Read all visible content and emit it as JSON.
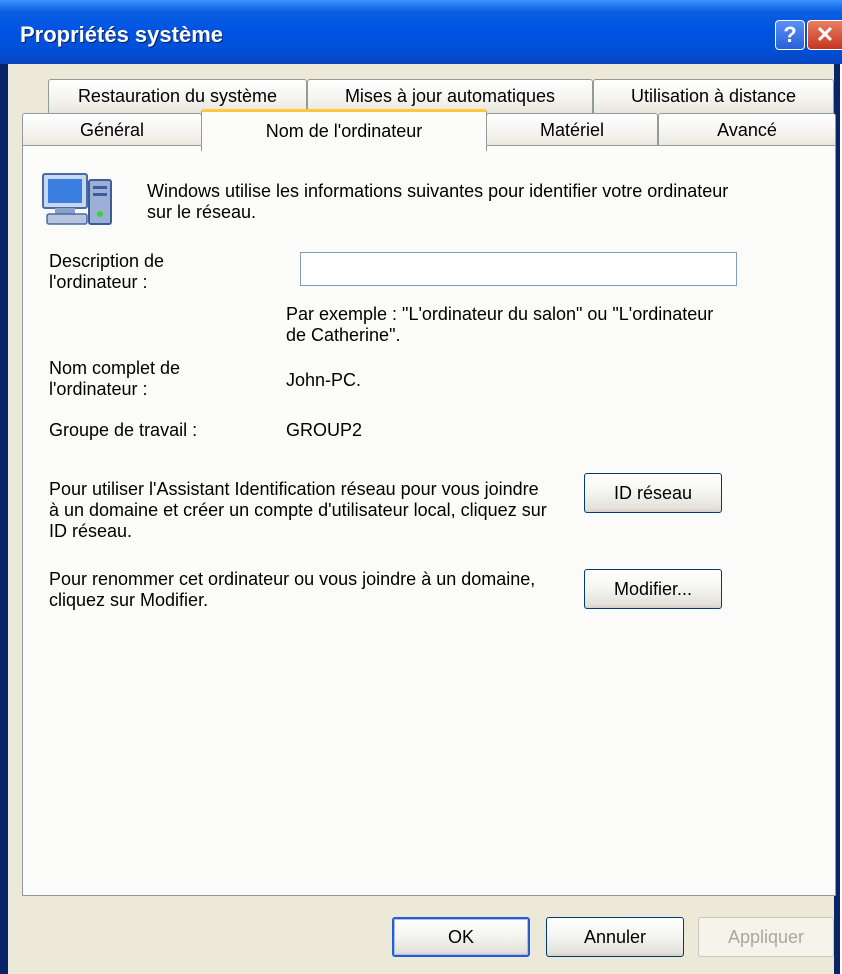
{
  "window": {
    "title": "Propriétés système"
  },
  "titlebar": {
    "help_glyph": "?",
    "close_glyph": "✕"
  },
  "tabs": {
    "row_back": [
      "Restauration du système",
      "Mises à jour automatiques",
      "Utilisation à distance"
    ],
    "row_front": [
      "Général",
      "Nom de l'ordinateur",
      "Matériel",
      "Avancé"
    ],
    "active": "Nom de l'ordinateur"
  },
  "content": {
    "intro": "Windows utilise les informations suivantes pour identifier votre ordinateur sur le réseau.",
    "description_label": "Description de l'ordinateur :",
    "description_value": "",
    "example_text": "Par exemple : \"L'ordinateur du salon\" ou \"L'ordinateur de Catherine\".",
    "fullname_label": "Nom complet de l'ordinateur :",
    "fullname_value": "John-PC.",
    "workgroup_label": "Groupe de travail :",
    "workgroup_value": "GROUP2",
    "network_id_text": "Pour utiliser l'Assistant Identification réseau pour vous joindre à un domaine et créer un compte d'utilisateur local, cliquez sur ID réseau.",
    "network_id_button": "ID réseau",
    "rename_text": "Pour renommer cet ordinateur ou vous joindre à un domaine, cliquez sur Modifier.",
    "rename_button": "Modifier..."
  },
  "footer": {
    "ok": "OK",
    "cancel": "Annuler",
    "apply": "Appliquer"
  },
  "icons": {
    "header_icon": "computer-network-icon"
  },
  "colors": {
    "titlebar": "#0054e3",
    "dialog_bg": "#ece9d8",
    "active_tab_accent": "#ffc83c"
  }
}
